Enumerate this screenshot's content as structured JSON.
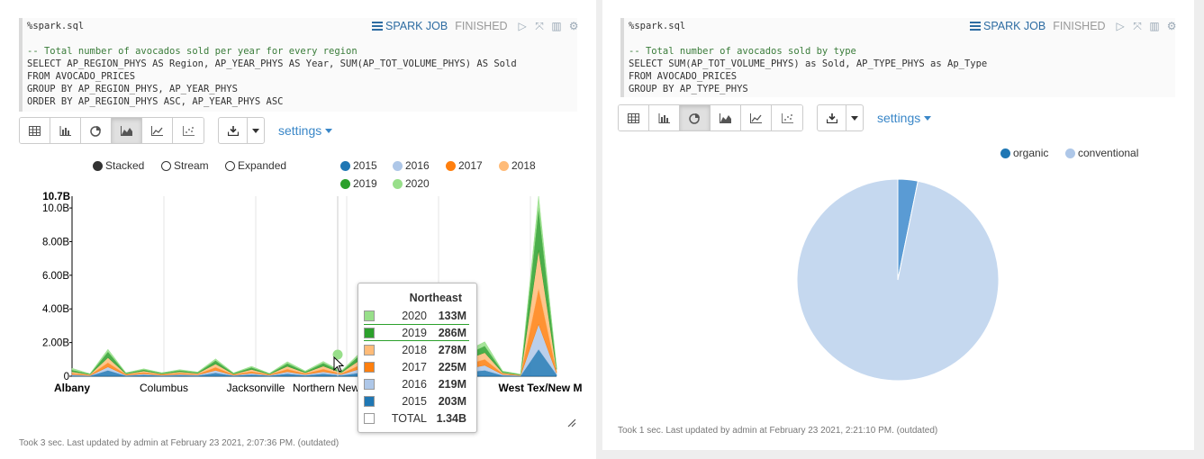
{
  "paragraph1": {
    "magic": "%spark.sql",
    "code": [
      {
        "text": "-- Total number of avocados sold per year for every region",
        "kind": "comment"
      },
      {
        "text": "SELECT AP_REGION_PHYS AS Region, AP_YEAR_PHYS AS Year, SUM(AP_TOT_VOLUME_PHYS) AS Sold"
      },
      {
        "text": "FROM AVOCADO_PRICES"
      },
      {
        "text": "GROUP BY AP_REGION_PHYS, AP_YEAR_PHYS"
      },
      {
        "text": "ORDER BY AP_REGION_PHYS ASC, AP_YEAR_PHYS ASC"
      }
    ],
    "job_label": "SPARK JOB",
    "status": "FINISHED",
    "settings_label": "settings",
    "active_view": "area",
    "footer": "Took 3 sec. Last updated by admin at February 23 2021, 2:07:36 PM. (outdated)",
    "stack_modes": [
      {
        "label": "Stacked",
        "selected": true
      },
      {
        "label": "Stream",
        "selected": false
      },
      {
        "label": "Expanded",
        "selected": false
      }
    ],
    "tooltip": {
      "title": "Northeast",
      "rows": [
        {
          "year": "2020",
          "value": "133M",
          "color": "#98df8a"
        },
        {
          "year": "2019",
          "value": "286M",
          "color": "#2ca02c",
          "highlight": true
        },
        {
          "year": "2018",
          "value": "278M",
          "color": "#ffbb78"
        },
        {
          "year": "2017",
          "value": "225M",
          "color": "#ff7f0e"
        },
        {
          "year": "2016",
          "value": "219M",
          "color": "#aec7e8"
        },
        {
          "year": "2015",
          "value": "203M",
          "color": "#1f77b4"
        },
        {
          "year": "TOTAL",
          "value": "1.34B",
          "color": "#ffffff"
        }
      ]
    }
  },
  "paragraph2": {
    "magic": "%spark.sql",
    "code": [
      {
        "text": "-- Total number of avocados sold by type",
        "kind": "comment"
      },
      {
        "text": "SELECT SUM(AP_TOT_VOLUME_PHYS) as Sold, AP_TYPE_PHYS as Ap_Type"
      },
      {
        "text": "FROM AVOCADO_PRICES"
      },
      {
        "text": "GROUP BY AP_TYPE_PHYS"
      }
    ],
    "job_label": "SPARK JOB",
    "status": "FINISHED",
    "settings_label": "settings",
    "active_view": "pie",
    "footer": "Took 1 sec. Last updated by admin at February 23 2021, 2:21:10 PM. (outdated)"
  },
  "chart_data": [
    {
      "type": "area",
      "stacked": true,
      "x_tick_labels": [
        "Albany",
        "Columbus",
        "Jacksonville",
        "Northern New",
        "West Tex/New M"
      ],
      "y_tick_labels": [
        "0",
        "2.00B",
        "4.00B",
        "6.00B",
        "8.00B",
        "10.0B",
        "10.7B"
      ],
      "ylim": [
        0,
        10.7
      ],
      "y_unit": "B",
      "legend_position": "top-right",
      "series": [
        {
          "name": "2015",
          "color": "#1f77b4"
        },
        {
          "name": "2016",
          "color": "#aec7e8"
        },
        {
          "name": "2017",
          "color": "#ff7f0e"
        },
        {
          "name": "2018",
          "color": "#ffbb78"
        },
        {
          "name": "2019",
          "color": "#2ca02c"
        },
        {
          "name": "2020",
          "color": "#98df8a"
        }
      ],
      "profile": [
        [
          0.05,
          0.05,
          0.07,
          0.1,
          0.1,
          0.1
        ],
        [
          0.02,
          0.02,
          0.03,
          0.03,
          0.03,
          0.02
        ],
        [
          0.35,
          0.2,
          0.25,
          0.3,
          0.35,
          0.15
        ],
        [
          0.03,
          0.03,
          0.04,
          0.04,
          0.04,
          0.03
        ],
        [
          0.08,
          0.06,
          0.08,
          0.09,
          0.08,
          0.05
        ],
        [
          0.03,
          0.03,
          0.04,
          0.04,
          0.04,
          0.03
        ],
        [
          0.06,
          0.05,
          0.07,
          0.08,
          0.08,
          0.05
        ],
        [
          0.04,
          0.04,
          0.04,
          0.05,
          0.05,
          0.03
        ],
        [
          0.2,
          0.15,
          0.18,
          0.2,
          0.2,
          0.1
        ],
        [
          0.03,
          0.03,
          0.03,
          0.04,
          0.04,
          0.03
        ],
        [
          0.1,
          0.08,
          0.1,
          0.12,
          0.12,
          0.07
        ],
        [
          0.03,
          0.03,
          0.03,
          0.03,
          0.03,
          0.02
        ],
        [
          0.15,
          0.12,
          0.15,
          0.17,
          0.17,
          0.1
        ],
        [
          0.05,
          0.05,
          0.05,
          0.06,
          0.06,
          0.04
        ],
        [
          0.15,
          0.12,
          0.15,
          0.18,
          0.18,
          0.1
        ],
        [
          0.05,
          0.05,
          0.05,
          0.06,
          0.06,
          0.04
        ],
        [
          0.2,
          0.22,
          0.23,
          0.28,
          0.29,
          0.13
        ],
        [
          0.05,
          0.05,
          0.05,
          0.06,
          0.06,
          0.04
        ],
        [
          0.1,
          0.08,
          0.1,
          0.12,
          0.12,
          0.07
        ],
        [
          0.08,
          0.07,
          0.08,
          0.1,
          0.1,
          0.06
        ],
        [
          0.12,
          0.1,
          0.12,
          0.15,
          0.15,
          0.09
        ],
        [
          0.05,
          0.05,
          0.05,
          0.06,
          0.06,
          0.04
        ],
        [
          0.25,
          0.2,
          0.25,
          0.3,
          0.3,
          0.2
        ],
        [
          0.35,
          0.3,
          0.35,
          0.4,
          0.4,
          0.25
        ],
        [
          0.05,
          0.05,
          0.05,
          0.06,
          0.06,
          0.04
        ],
        [
          0.02,
          0.02,
          0.02,
          0.02,
          0.02,
          0.02
        ],
        [
          1.6,
          1.5,
          2.1,
          2.3,
          2.5,
          0.7
        ],
        [
          0.1,
          0.08,
          0.1,
          0.12,
          0.12,
          0.08
        ]
      ]
    },
    {
      "type": "pie",
      "categories": [
        "organic",
        "conventional"
      ],
      "values": [
        3.2,
        96.8
      ],
      "colors": [
        "#5a9bd4",
        "#c5d8ef"
      ],
      "legend_position": "top-right"
    }
  ]
}
